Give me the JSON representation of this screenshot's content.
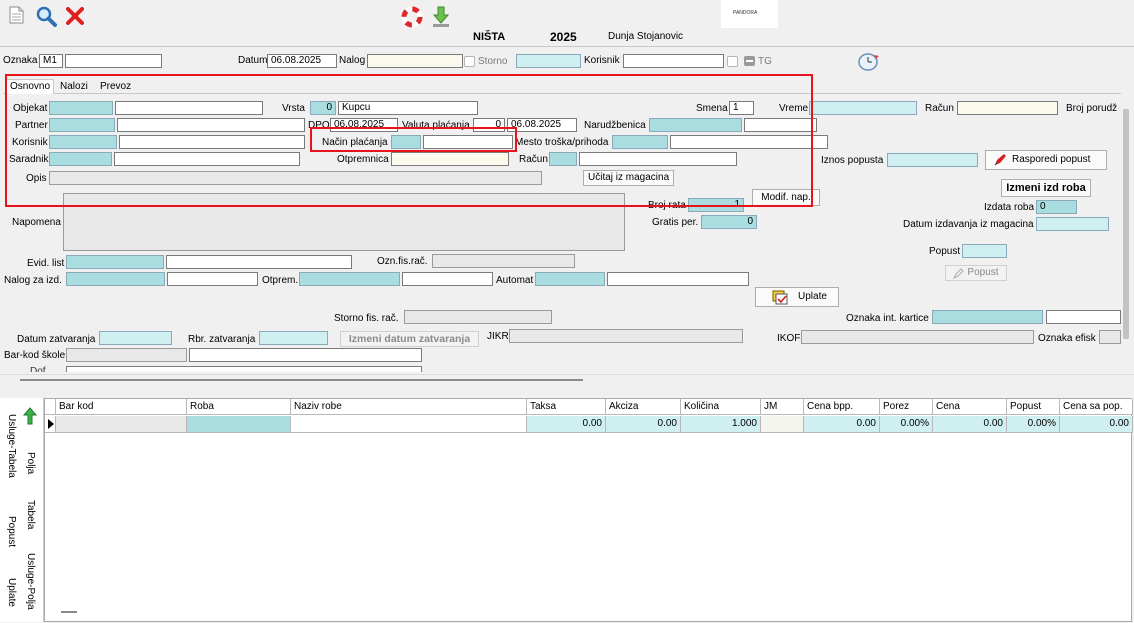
{
  "header": {
    "title": "NIŠTA",
    "year": "2025",
    "user_name": "Dunja Stojanovic",
    "logo_text": "PANDORA",
    "icons": [
      "document-icon",
      "search-icon",
      "close-icon",
      "lifebuoy-icon",
      "download-icon"
    ]
  },
  "topbar": {
    "oznaka_label": "Oznaka",
    "oznaka_value": "M1",
    "datum_label": "Datum",
    "datum_value": "06.08.2025",
    "nalog_label": "Nalog",
    "storno_label": "Storno",
    "korisnik_label": "Korisnik",
    "tg_label": "TG"
  },
  "tabs": [
    "Osnovno",
    "Nalozi",
    "Prevoz"
  ],
  "form": {
    "objekat_label": "Objekat",
    "partner_label": "Partner",
    "korisnik_label": "Korisnik",
    "saradnik_label": "Saradnik",
    "opis_label": "Opis",
    "vrsta_label": "Vrsta",
    "vrsta_value": "0",
    "vrsta_name": "Kupcu",
    "dpo_label": "DPO",
    "dpo_value": "06.08.2025",
    "valuta_label": "Valuta plaćanja",
    "valuta_days": "0",
    "valuta_date": "06.08.2025",
    "nacin_label": "Način plaćanja",
    "otpremnica_label": "Otpremnica",
    "racun_label": "Račun",
    "ucitaj_button": "Učitaj iz magacina",
    "smena_label": "Smena",
    "smena_value": "1",
    "vreme_label": "Vreme",
    "racun2_label": "Račun",
    "broj_porudz_label": "Broj porudž",
    "narudzbenica_label": "Narudžbenica",
    "mesto_label": "Mesto troška/prihoda",
    "iznos_popusta_label": "Iznos popusta",
    "rasporedi_button": "Rasporedi popust",
    "izmeni_button": "Izmeni izd roba",
    "broj_rata_label": "Broj rata",
    "broj_rata_value": "1",
    "modif_button": "Modif. nap.",
    "gratis_label": "Gratis per.",
    "gratis_value": "0",
    "izdata_roba_label": "Izdata roba",
    "izdata_roba_value": "0",
    "datum_izdavanja_label": "Datum izdavanja iz magacina",
    "napomena_label": "Napomena",
    "popust_label": "Popust",
    "popust_button": "Popust",
    "evid_label": "Evid. list",
    "ozn_fis_label": "Ozn.fis.rač.",
    "nalog_izd_label": "Nalog za izd.",
    "otprem_label": "Otprem.",
    "automat_label": "Automat",
    "uplate_button": "Uplate",
    "storno_fis_label": "Storno fis. rač.",
    "oznaka_kartice_label": "Oznaka int. kartice",
    "datum_zatv_label": "Datum zatvaranja",
    "rbr_zatv_label": "Rbr. zatvaranja",
    "izmeni_datum_button": "Izmeni datum zatvaranja",
    "jikr_label": "JIKR",
    "ikof_label": "IKOF",
    "oznaka_efisk_label": "Oznaka efisk",
    "barkod_label": "Bar-kod škole",
    "cut_label": "Dof..."
  },
  "grid": {
    "columns": [
      "Bar kod",
      "Roba",
      "Naziv robe",
      "Taksa",
      "Akciza",
      "Količina",
      "JM",
      "Cena bpp.",
      "Porez",
      "Cena",
      "Popust",
      "Cena sa pop."
    ],
    "row": [
      "",
      "",
      "",
      "0.00",
      "0.00",
      "1.000",
      "",
      "0.00",
      "0.00%",
      "0.00",
      "0.00%",
      "0.00"
    ]
  },
  "side_tabs": [
    "Usluge-Tabela",
    "Polja",
    "Tabela",
    "Popust",
    "Usluge-Polja",
    "Uplate"
  ],
  "colors": {
    "cyan_field": "#a9dde0",
    "highlight_red": "#e8141b"
  }
}
